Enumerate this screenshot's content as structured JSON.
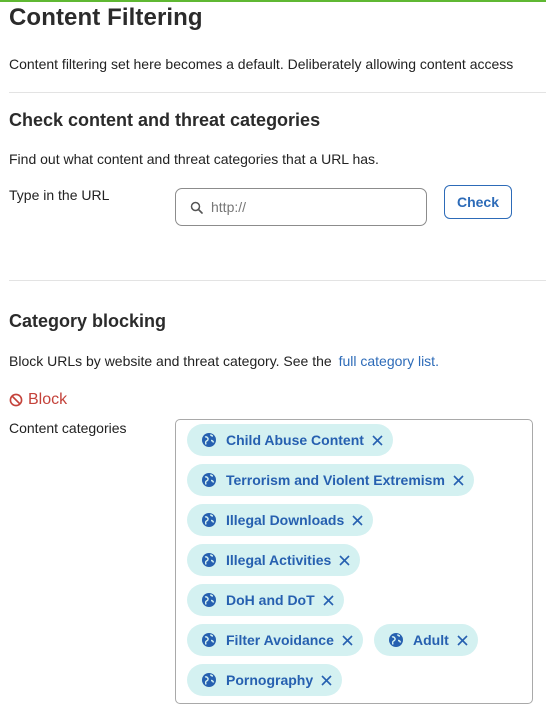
{
  "header": {
    "title": "Content Filtering",
    "intro": "Content filtering set here becomes a default. Deliberately allowing content access"
  },
  "check_section": {
    "title": "Check content and threat categories",
    "description": "Find out what content and threat categories that a URL has.",
    "url_label": "Type in the URL",
    "url_placeholder": "http://",
    "url_value": "",
    "check_label": "Check"
  },
  "blocking_section": {
    "title": "Category blocking",
    "description": "Block URLs by website and threat category. See the",
    "link_text": "full category list.",
    "block_label": "Block",
    "content_categories_label": "Content categories",
    "categories": [
      {
        "label": "Child Abuse Content",
        "highlighted": true
      },
      {
        "label": "Terrorism and Violent Extremism",
        "highlighted": false
      },
      {
        "label": "Illegal Downloads",
        "highlighted": false
      },
      {
        "label": "Illegal Activities",
        "highlighted": false
      },
      {
        "label": "DoH and DoT",
        "highlighted": true
      },
      {
        "label": "Filter Avoidance",
        "highlighted": true
      },
      {
        "label": "Adult",
        "highlighted": true
      },
      {
        "label": "Pornography",
        "highlighted": true
      }
    ]
  },
  "colors": {
    "accent": "#2d6bb8",
    "chip_bg": "#d4f1f1",
    "block_red": "#c4423a",
    "highlight": "#d6ef00",
    "top_bar": "#5fb832"
  },
  "icons": {
    "search": "search-icon",
    "block": "block-icon",
    "globe": "globe-icon",
    "remove": "close-icon"
  }
}
